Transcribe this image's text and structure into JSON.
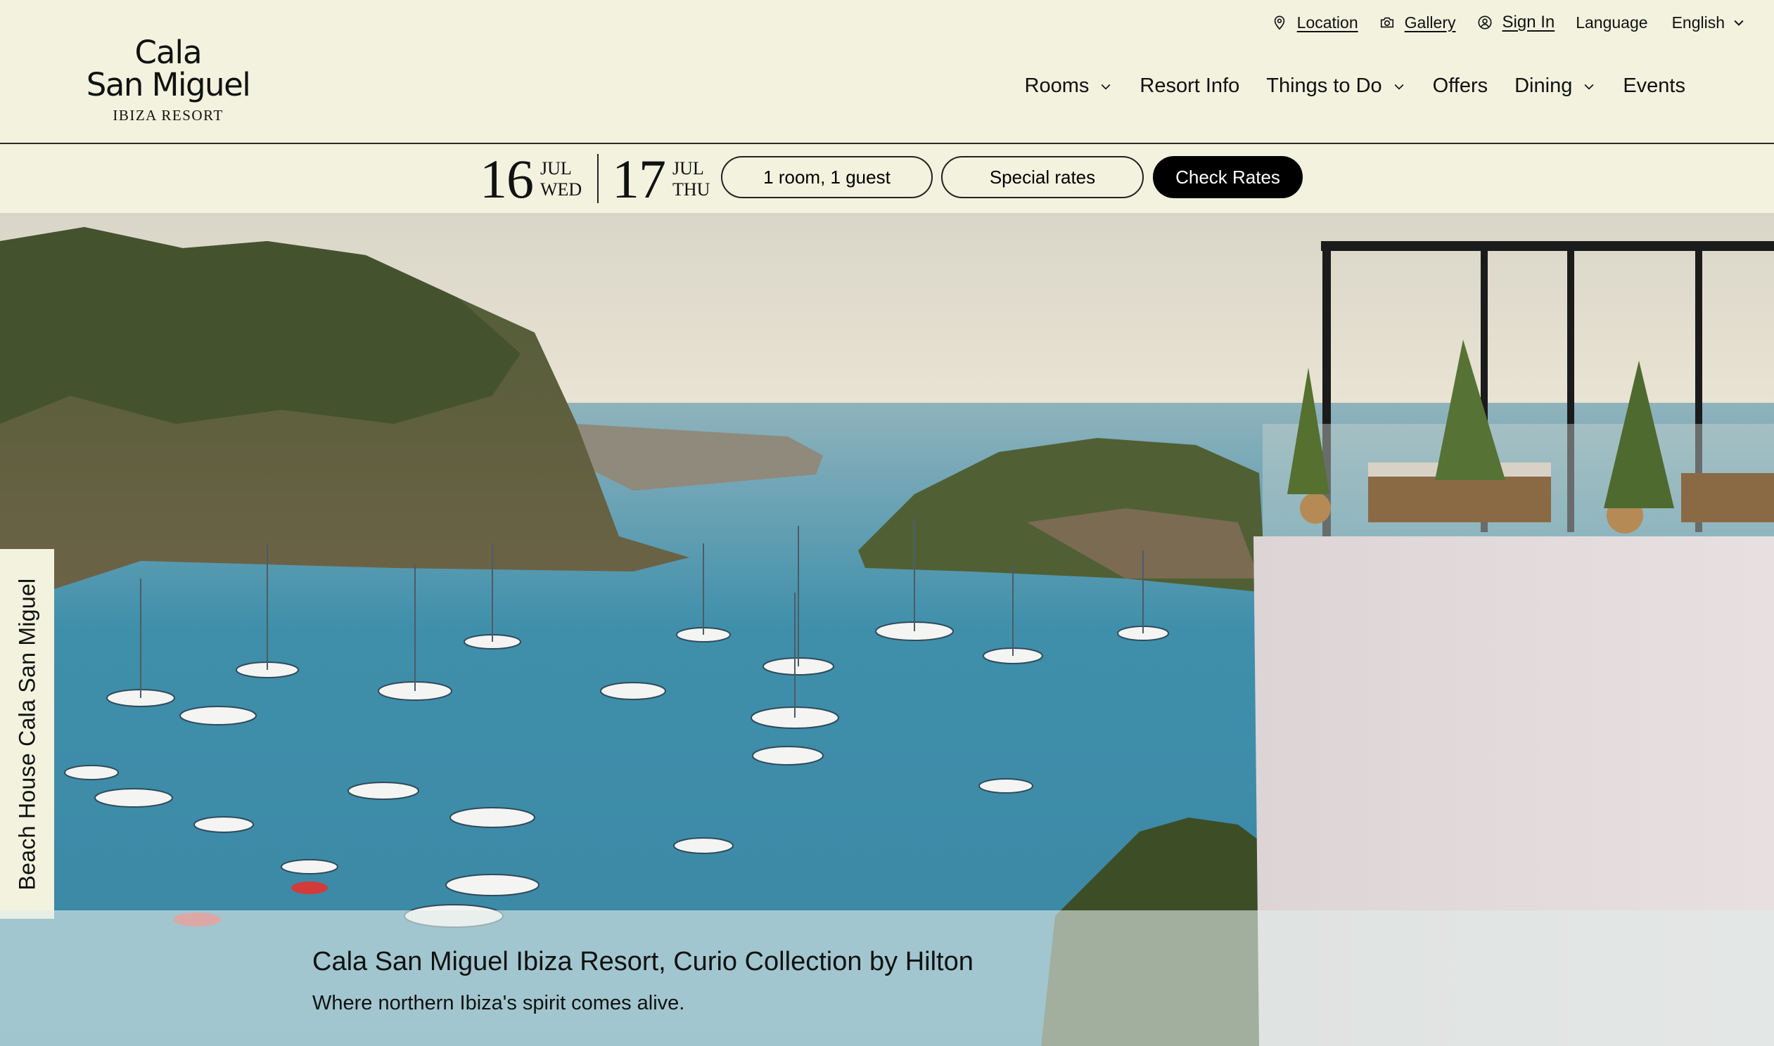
{
  "brand": {
    "logo_line1": "Cala",
    "logo_line2": "San Miguel",
    "logo_line3": "IBIZA RESORT"
  },
  "utility_nav": {
    "location": "Location",
    "gallery": "Gallery",
    "sign_in": "Sign In",
    "language_label": "Language",
    "language_value": "English"
  },
  "main_nav": {
    "rooms": "Rooms",
    "resort_info": "Resort Info",
    "things_to_do": "Things to Do",
    "offers": "Offers",
    "dining": "Dining",
    "events": "Events"
  },
  "booking": {
    "checkin": {
      "day": "16",
      "month": "JUL",
      "weekday": "WED"
    },
    "checkout": {
      "day": "17",
      "month": "JUL",
      "weekday": "THU"
    },
    "guests": "1 room, 1 guest",
    "special_rates": "Special rates",
    "check_rates": "Check Rates"
  },
  "hero": {
    "side_tab": "Beach House Cala San Miguel",
    "title": "Cala San Miguel Ibiza Resort, Curio Collection by Hilton",
    "subtitle": "Where northern Ibiza's spirit comes alive."
  },
  "icons": {
    "location": "map-pin-icon",
    "gallery": "camera-icon",
    "sign_in": "user-circle-icon",
    "chevron": "chevron-down-icon"
  }
}
